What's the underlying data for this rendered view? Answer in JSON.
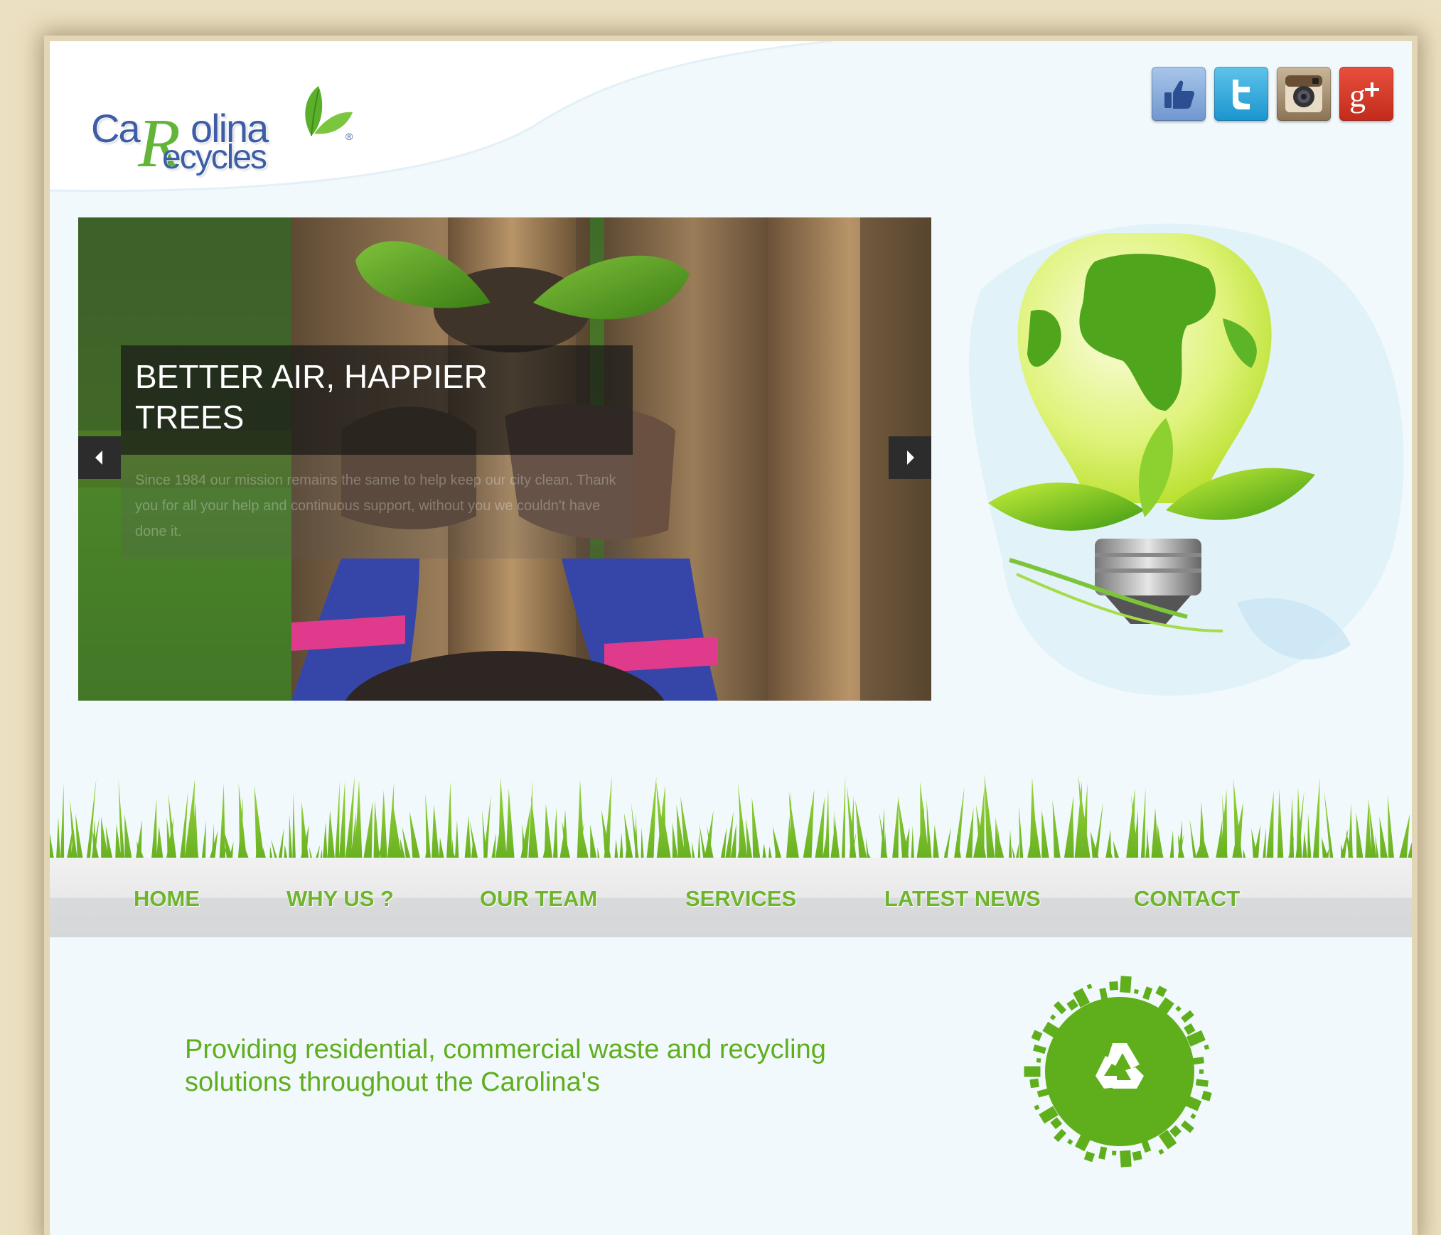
{
  "brand": {
    "logo_text_1": "Ca",
    "logo_text_big_r": "R",
    "logo_text_2": "olina",
    "logo_text_3": "ecycles",
    "logo_reg_mark": "®",
    "primary_color": "#3d5ea6",
    "accent_color": "#63b53a"
  },
  "social": [
    {
      "name": "facebook",
      "icon": "thumbs-up-icon"
    },
    {
      "name": "twitter",
      "icon": "twitter-icon"
    },
    {
      "name": "instagram",
      "icon": "camera-icon"
    },
    {
      "name": "google-plus",
      "icon": "google-plus-icon"
    }
  ],
  "slider": {
    "title": "BETTER AIR, HAPPIER TREES",
    "text": "Since 1984 our mission remains the same to help keep our city clean. Thank you for all your help and continuous support, without you we couldn't have done it.",
    "prev_icon": "chevron-left-icon",
    "next_icon": "chevron-right-icon"
  },
  "nav": {
    "items": [
      {
        "label": "HOME"
      },
      {
        "label": "WHY US ?"
      },
      {
        "label": "OUR TEAM"
      },
      {
        "label": "SERVICES"
      },
      {
        "label": "LATEST NEWS"
      },
      {
        "label": "CONTACT"
      }
    ],
    "text_color": "#6eb52d"
  },
  "tagline": "Providing residential, commercial waste and recycling solutions throughout the Carolina's"
}
